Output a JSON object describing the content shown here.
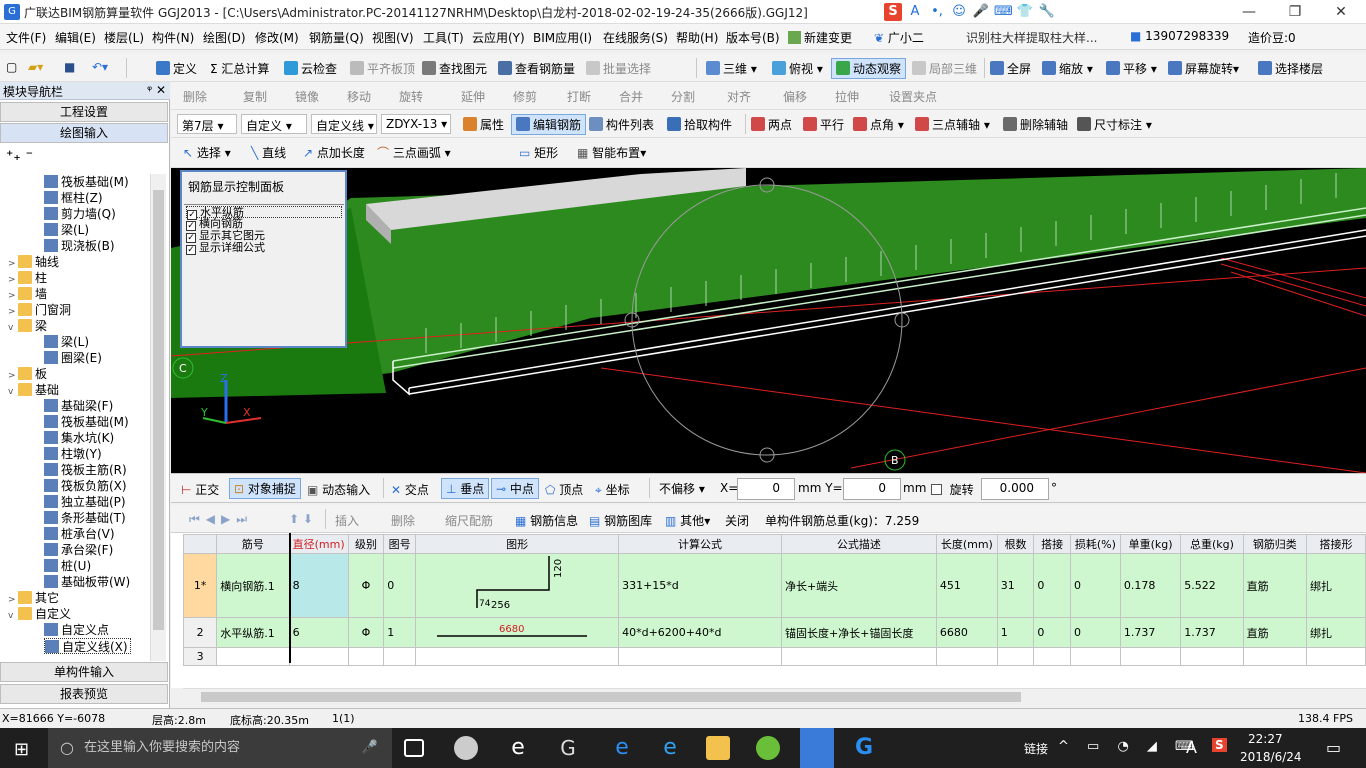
{
  "window": {
    "title": "广联达BIM钢筋算量软件 GGJ2013 - [C:\\Users\\Administrator.PC-20141127NRHM\\Desktop\\白龙村-2018-02-02-19-24-35(2666版).GGJ12]",
    "controls": [
      "—",
      "❐",
      "✕"
    ]
  },
  "ime": [
    "S",
    "A",
    "•,",
    "☺",
    "🎤",
    "⌨",
    "👕",
    "🔧"
  ],
  "menu": {
    "items": [
      "文件(F)",
      "编辑(E)",
      "楼层(L)",
      "构件(N)",
      "绘图(D)",
      "修改(M)",
      "钢筋量(Q)",
      "视图(V)",
      "工具(T)",
      "云应用(Y)",
      "BIM应用(I)",
      "在线服务(S)",
      "帮助(H)",
      "版本号(B)",
      "新建变更",
      "广小二"
    ],
    "hint": "识别柱大样提取柱大样...",
    "phone": "13907298339",
    "beans": "造价豆:0"
  },
  "toolbar1": {
    "items": [
      "定义",
      "Σ 汇总计算",
      "云检查",
      "平齐板顶",
      "查找图元",
      "查看钢筋量",
      "批量选择",
      "三维",
      "俯视",
      "动态观察",
      "局部三维",
      "全屏",
      "缩放",
      "平移",
      "屏幕旋转",
      "选择楼层"
    ]
  },
  "toolbar2": {
    "items": [
      "删除",
      "复制",
      "镜像",
      "移动",
      "旋转",
      "延伸",
      "修剪",
      "打断",
      "合并",
      "分割",
      "对齐",
      "偏移",
      "拉伸",
      "设置夹点"
    ]
  },
  "toolbar3": {
    "floor": "第7层",
    "type": "自定义",
    "sub_type": "自定义线",
    "element": "ZDYX-13",
    "items": [
      "属性",
      "编辑钢筋",
      "构件列表",
      "拾取构件",
      "两点",
      "平行",
      "点角",
      "三点辅轴",
      "删除辅轴",
      "尺寸标注"
    ]
  },
  "toolbar4": {
    "items": [
      "选择",
      "直线",
      "点加长度",
      "三点画弧",
      "矩形",
      "智能布置"
    ]
  },
  "nav": {
    "title": "模块导航栏",
    "buttons": [
      "工程设置",
      "绘图输入"
    ],
    "bottom_buttons": [
      "单构件输入",
      "报表预览"
    ],
    "tree": [
      {
        "label": "筏板基础(M)",
        "level": 2
      },
      {
        "label": "框柱(Z)",
        "level": 2
      },
      {
        "label": "剪力墙(Q)",
        "level": 2
      },
      {
        "label": "梁(L)",
        "level": 2
      },
      {
        "label": "现浇板(B)",
        "level": 2
      },
      {
        "label": "轴线",
        "level": 1,
        "exp": ">"
      },
      {
        "label": "柱",
        "level": 1,
        "exp": ">"
      },
      {
        "label": "墙",
        "level": 1,
        "exp": ">"
      },
      {
        "label": "门窗洞",
        "level": 1,
        "exp": ">"
      },
      {
        "label": "梁",
        "level": 1,
        "exp": "v"
      },
      {
        "label": "梁(L)",
        "level": 2
      },
      {
        "label": "圈梁(E)",
        "level": 2
      },
      {
        "label": "板",
        "level": 1,
        "exp": ">"
      },
      {
        "label": "基础",
        "level": 1,
        "exp": "v"
      },
      {
        "label": "基础梁(F)",
        "level": 2
      },
      {
        "label": "筏板基础(M)",
        "level": 2
      },
      {
        "label": "集水坑(K)",
        "level": 2
      },
      {
        "label": "柱墩(Y)",
        "level": 2
      },
      {
        "label": "筏板主筋(R)",
        "level": 2
      },
      {
        "label": "筏板负筋(X)",
        "level": 2
      },
      {
        "label": "独立基础(P)",
        "level": 2
      },
      {
        "label": "条形基础(T)",
        "level": 2
      },
      {
        "label": "桩承台(V)",
        "level": 2
      },
      {
        "label": "承台梁(F)",
        "level": 2
      },
      {
        "label": "桩(U)",
        "level": 2
      },
      {
        "label": "基础板带(W)",
        "level": 2
      },
      {
        "label": "其它",
        "level": 1,
        "exp": ">"
      },
      {
        "label": "自定义",
        "level": 1,
        "exp": "v"
      },
      {
        "label": "自定义点",
        "level": 2
      },
      {
        "label": "自定义线(X)",
        "level": 2
      }
    ]
  },
  "panel": {
    "title": "钢筋显示控制面板",
    "options": [
      "水平纵筋",
      "横向钢筋",
      "显示其它图元",
      "显示详细公式"
    ]
  },
  "viewport": {
    "axis_labels": [
      "C",
      "B"
    ],
    "axes": [
      "Z",
      "Y",
      "X"
    ]
  },
  "snapbar": {
    "items": [
      "正交",
      "对象捕捉",
      "动态输入",
      "交点",
      "垂点",
      "中点",
      "顶点",
      "坐标"
    ],
    "offset_mode": "不偏移",
    "x_label": "X=",
    "x_value": "0",
    "y_label": "mm  Y=",
    "y_value": "0",
    "unit": "mm",
    "rotate_label": "旋转",
    "rotate_value": "0.000",
    "degree": "°"
  },
  "grid_toolbar": {
    "items": [
      "插入",
      "删除",
      "缩尺配筋",
      "钢筋信息",
      "钢筋图库",
      "其他",
      "关闭"
    ],
    "total": "单构件钢筋总重(kg)：7.259"
  },
  "table": {
    "headers": [
      "筋号",
      "直径(mm)",
      "级别",
      "图号",
      "图形",
      "计算公式",
      "公式描述",
      "长度(mm)",
      "根数",
      "搭接",
      "损耗(%)",
      "单重(kg)",
      "总重(kg)",
      "钢筋归类",
      "搭接形"
    ],
    "rows": [
      {
        "num": "1*",
        "cells": [
          "横向钢筋.1",
          "8",
          "Φ",
          "0",
          "",
          "331+15*d",
          "净长+端头",
          "451",
          "31",
          "0",
          "0",
          "0.178",
          "5.522",
          "直筋",
          "绑扎"
        ],
        "shape": {
          "a": "120",
          "b": "74",
          "c": "256"
        }
      },
      {
        "num": "2",
        "cells": [
          "水平纵筋.1",
          "6",
          "Φ",
          "1",
          "",
          "40*d+6200+40*d",
          "锚固长度+净长+锚固长度",
          "6680",
          "1",
          "0",
          "0",
          "1.737",
          "1.737",
          "直筋",
          "绑扎"
        ],
        "shape": {
          "len": "6680"
        }
      },
      {
        "num": "3",
        "cells": [
          "",
          "",
          "",
          "",
          "",
          "",
          "",
          "",
          "",
          "",
          "",
          "",
          "",
          "",
          ""
        ]
      }
    ]
  },
  "status": {
    "coords": "X=81666 Y=-6078",
    "floor_height": "层高:2.8m",
    "base_height": "底标高:20.35m",
    "count": "1(1)",
    "fps": "138.4 FPS"
  },
  "taskbar": {
    "search": "在这里输入你要搜索的内容",
    "link": "链接",
    "time": "22:27",
    "date": "2018/6/24"
  }
}
